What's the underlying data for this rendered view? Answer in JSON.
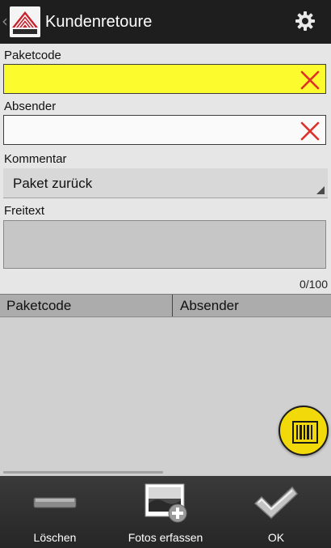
{
  "header": {
    "back_glyph": "‹",
    "title": "Kundenretoure",
    "logo_icon": "company-logo",
    "settings_icon": "gear-icon"
  },
  "form": {
    "paketcode_label": "Paketcode",
    "paketcode_value": "",
    "absender_label": "Absender",
    "absender_value": "",
    "kommentar_label": "Kommentar",
    "kommentar_value": "Paket zurück",
    "freitext_label": "Freitext",
    "freitext_value": "",
    "counter": "0/100",
    "colors": {
      "highlight": "#fbfb2e",
      "clear_icon": "#e0302a"
    }
  },
  "table": {
    "columns": [
      "Paketcode",
      "Absender"
    ],
    "rows": []
  },
  "scan_button": {
    "icon": "barcode-icon",
    "color": "#f2d90a"
  },
  "actions": [
    {
      "label": "Löschen",
      "icon": "minus-icon"
    },
    {
      "label": "Fotos erfassen",
      "icon": "add-photo-icon"
    },
    {
      "label": "OK",
      "icon": "check-icon"
    }
  ]
}
